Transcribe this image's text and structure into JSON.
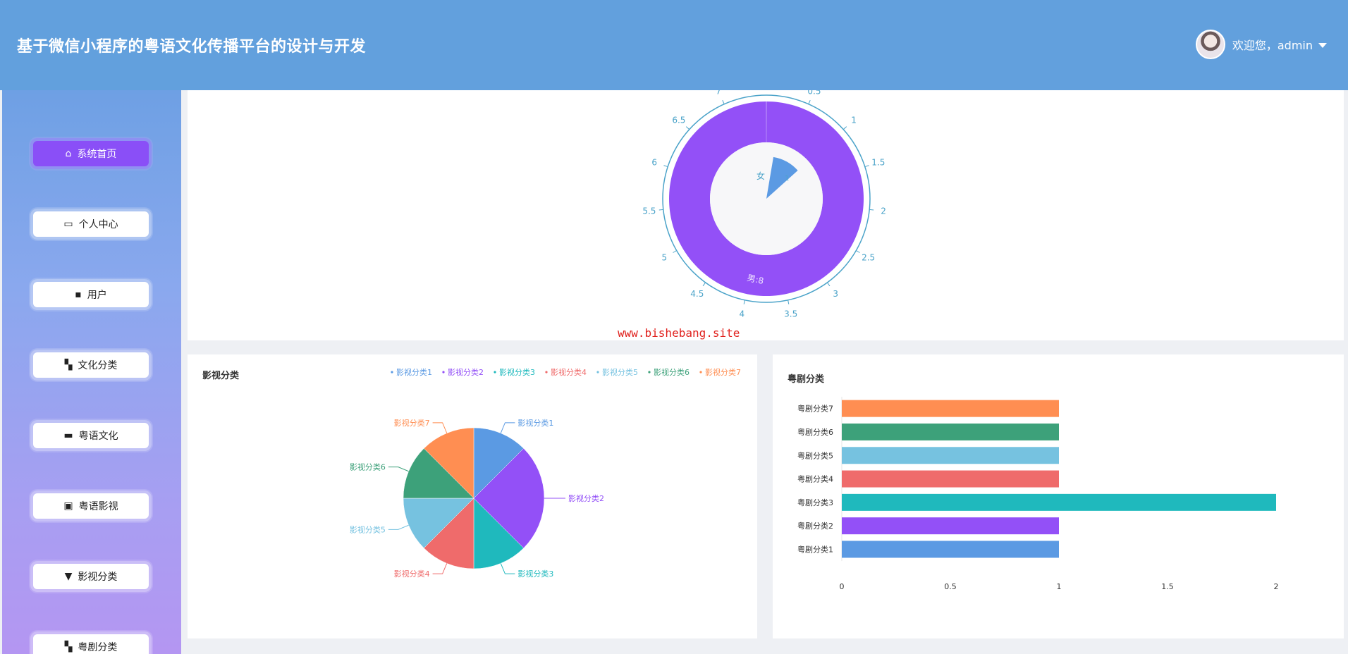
{
  "app": {
    "title": "基于微信小程序的粤语文化传播平台的设计与开发",
    "welcome": "欢迎您，admin"
  },
  "sidebar": {
    "items": [
      {
        "label": "系统首页",
        "icon": "home-icon",
        "active": true
      },
      {
        "label": "个人中心",
        "icon": "id-card-icon",
        "active": false
      },
      {
        "label": "用户",
        "icon": "chat-icon",
        "active": false
      },
      {
        "label": "文化分类",
        "icon": "grid-icon",
        "active": false
      },
      {
        "label": "粤语文化",
        "icon": "cap-icon",
        "active": false
      },
      {
        "label": "粤语影视",
        "icon": "clipboard-icon",
        "active": false
      },
      {
        "label": "影视分类",
        "icon": "pin-icon",
        "active": false
      },
      {
        "label": "粤剧分类",
        "icon": "grid-icon",
        "active": false
      }
    ]
  },
  "watermark": "www.bishebang.site",
  "chart_data": [
    {
      "type": "pie",
      "variant": "polar-bar",
      "categories": [
        "女",
        "男"
      ],
      "values": [
        1,
        8
      ],
      "labels": [
        "女",
        "男:8"
      ],
      "radial_labels": [
        "1"
      ],
      "angle_ticks": [
        "0.5",
        "1",
        "1.5",
        "2",
        "2.5",
        "3",
        "3.5",
        "4",
        "4.5",
        "5",
        "5.5",
        "6",
        "6.5",
        "7"
      ],
      "angle_max": 7.5,
      "colors": [
        "#5b9ae3",
        "#9350f7"
      ]
    },
    {
      "type": "pie",
      "title": "影视分类",
      "categories": [
        "影视分类1",
        "影视分类2",
        "影视分类3",
        "影视分类4",
        "影视分类5",
        "影视分类6",
        "影视分类7"
      ],
      "values": [
        1,
        2,
        1,
        1,
        1,
        1,
        1
      ],
      "colors": [
        "#5b9ae3",
        "#9350f7",
        "#1fb9bd",
        "#ef6b6b",
        "#76c2e0",
        "#3da17a",
        "#ff8e52"
      ],
      "legend": "top-right"
    },
    {
      "type": "bar",
      "orientation": "horizontal",
      "title": "粤剧分类",
      "categories": [
        "粤剧分类1",
        "粤剧分类2",
        "粤剧分类3",
        "粤剧分类4",
        "粤剧分类5",
        "粤剧分类6",
        "粤剧分类7"
      ],
      "values": [
        1,
        1,
        2,
        1,
        1,
        1,
        1
      ],
      "xlim": [
        0,
        2
      ],
      "x_ticks": [
        "0",
        "0.5",
        "1",
        "1.5",
        "2"
      ],
      "colors": [
        "#5b9ae3",
        "#9350f7",
        "#1fb9bd",
        "#ef6b6b",
        "#76c2e0",
        "#3da17a",
        "#ff8e52"
      ]
    }
  ]
}
